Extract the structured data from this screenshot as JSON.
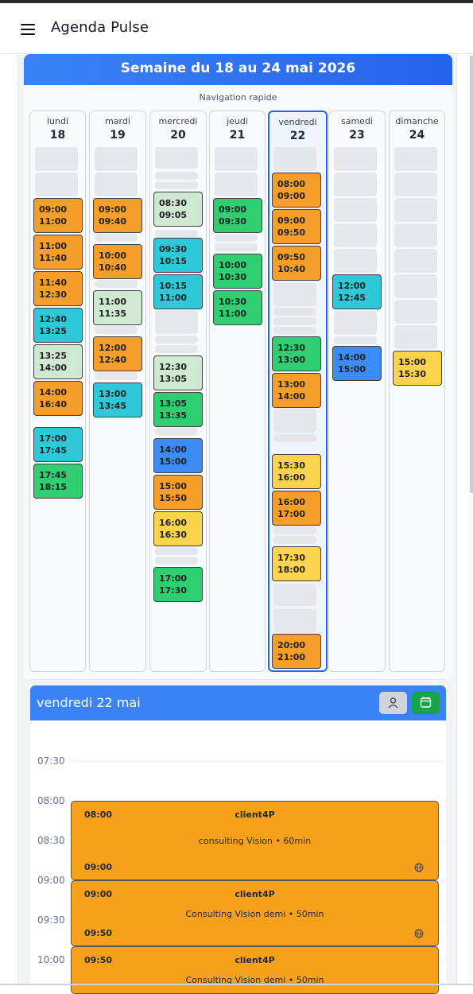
{
  "app": {
    "title": "Agenda Pulse"
  },
  "week": {
    "title": "Semaine du 18 au 24 mai 2026",
    "nav_label": "Navigation rapide",
    "days": [
      {
        "name": "lundi",
        "num": "18",
        "selected": false,
        "appointments": [
          {
            "start": "09:00",
            "end": "11:00",
            "color": "orange"
          },
          {
            "start": "11:00",
            "end": "11:40",
            "color": "orange"
          },
          {
            "start": "11:40",
            "end": "12:30",
            "color": "orange"
          },
          {
            "start": "12:40",
            "end": "13:25",
            "color": "cyan"
          },
          {
            "start": "13:25",
            "end": "14:00",
            "color": "pale"
          },
          {
            "start": "14:00",
            "end": "16:40",
            "color": "orange"
          },
          {
            "start": "17:00",
            "end": "17:45",
            "color": "cyan"
          },
          {
            "start": "17:45",
            "end": "18:15",
            "color": "green"
          }
        ]
      },
      {
        "name": "mardi",
        "num": "19",
        "selected": false,
        "appointments": [
          {
            "start": "09:00",
            "end": "09:40",
            "color": "orange"
          },
          {
            "start": "10:00",
            "end": "10:40",
            "color": "orange"
          },
          {
            "start": "11:00",
            "end": "11:35",
            "color": "pale"
          },
          {
            "start": "12:00",
            "end": "12:40",
            "color": "orange"
          },
          {
            "start": "13:00",
            "end": "13:45",
            "color": "cyan"
          }
        ]
      },
      {
        "name": "mercredi",
        "num": "20",
        "selected": false,
        "appointments": [
          {
            "start": "08:30",
            "end": "09:05",
            "color": "pale"
          },
          {
            "start": "09:30",
            "end": "10:15",
            "color": "cyan"
          },
          {
            "start": "10:15",
            "end": "11:00",
            "color": "cyan"
          },
          {
            "start": "12:30",
            "end": "13:05",
            "color": "pale"
          },
          {
            "start": "13:05",
            "end": "13:35",
            "color": "green"
          },
          {
            "start": "14:00",
            "end": "15:00",
            "color": "blue"
          },
          {
            "start": "15:00",
            "end": "15:50",
            "color": "orange"
          },
          {
            "start": "16:00",
            "end": "16:30",
            "color": "yellow"
          },
          {
            "start": "17:00",
            "end": "17:30",
            "color": "green"
          }
        ]
      },
      {
        "name": "jeudi",
        "num": "21",
        "selected": false,
        "appointments": [
          {
            "start": "09:00",
            "end": "09:30",
            "color": "green"
          },
          {
            "start": "10:00",
            "end": "10:30",
            "color": "green"
          },
          {
            "start": "10:30",
            "end": "11:00",
            "color": "green"
          }
        ]
      },
      {
        "name": "vendredi",
        "num": "22",
        "selected": true,
        "appointments": [
          {
            "start": "08:00",
            "end": "09:00",
            "color": "orange"
          },
          {
            "start": "09:00",
            "end": "09:50",
            "color": "orange"
          },
          {
            "start": "09:50",
            "end": "10:40",
            "color": "orange"
          },
          {
            "start": "12:30",
            "end": "13:00",
            "color": "green"
          },
          {
            "start": "13:00",
            "end": "14:00",
            "color": "orange"
          },
          {
            "start": "15:30",
            "end": "16:00",
            "color": "yellow"
          },
          {
            "start": "16:00",
            "end": "17:00",
            "color": "orange"
          },
          {
            "start": "17:30",
            "end": "18:00",
            "color": "yellow"
          },
          {
            "start": "20:00",
            "end": "21:00",
            "color": "orange"
          }
        ]
      },
      {
        "name": "samedi",
        "num": "23",
        "selected": false,
        "appointments": [
          {
            "start": "12:00",
            "end": "12:45",
            "color": "cyan"
          },
          {
            "start": "14:00",
            "end": "15:00",
            "color": "blue"
          }
        ]
      },
      {
        "name": "dimanche",
        "num": "24",
        "selected": false,
        "appointments": [
          {
            "start": "15:00",
            "end": "15:30",
            "color": "yellow"
          }
        ]
      }
    ]
  },
  "day_view": {
    "title": "vendredi 22 mai",
    "buttons": {
      "person_icon": "person-icon",
      "calendar_icon": "calendar-icon"
    },
    "time_labels": [
      "07:30",
      "08:00",
      "08:30",
      "09:00",
      "09:30",
      "10:00"
    ],
    "appointments": [
      {
        "start": "08:00",
        "end": "09:00",
        "client": "client4P",
        "description": "consulting Vision • 60min",
        "icon": "globe-icon"
      },
      {
        "start": "09:00",
        "end": "09:50",
        "client": "client4P",
        "description": "Consulting Vision demi • 50min",
        "icon": "globe-icon"
      },
      {
        "start": "09:50",
        "end": "",
        "client": "client4P",
        "description": "Consulting Vision demi • 50min",
        "icon": ""
      }
    ]
  }
}
